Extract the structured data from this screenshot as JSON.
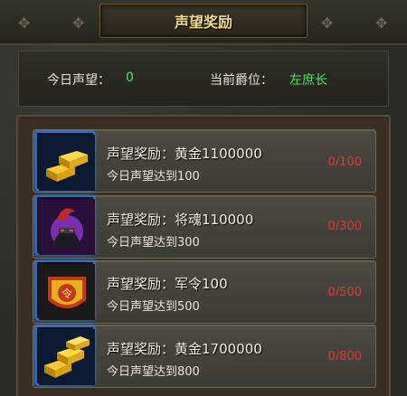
{
  "header": {
    "title": "声望奖励"
  },
  "stats": {
    "today_label": "今日声望：",
    "today_value": "0",
    "rank_label": "当前爵位：",
    "rank_value": "左庶长"
  },
  "rewards": [
    {
      "title": "声望奖励：黄金1100000",
      "requirement": "今日声望达到100",
      "progress": "0/100",
      "icon": "gold-bars-icon"
    },
    {
      "title": "声望奖励：将魂110000",
      "requirement": "今日声望达到300",
      "progress": "0/300",
      "icon": "general-soul-icon"
    },
    {
      "title": "声望奖励：军令100",
      "requirement": "今日声望达到500",
      "progress": "0/500",
      "icon": "military-order-icon"
    },
    {
      "title": "声望奖励：黄金1700000",
      "requirement": "今日声望达到800",
      "progress": "0/800",
      "icon": "gold-bars-icon"
    }
  ],
  "colors": {
    "title": "#f3d98a",
    "value_green": "#58e35a",
    "progress_red": "#e03535",
    "icon_border": "#2c6ccf"
  }
}
